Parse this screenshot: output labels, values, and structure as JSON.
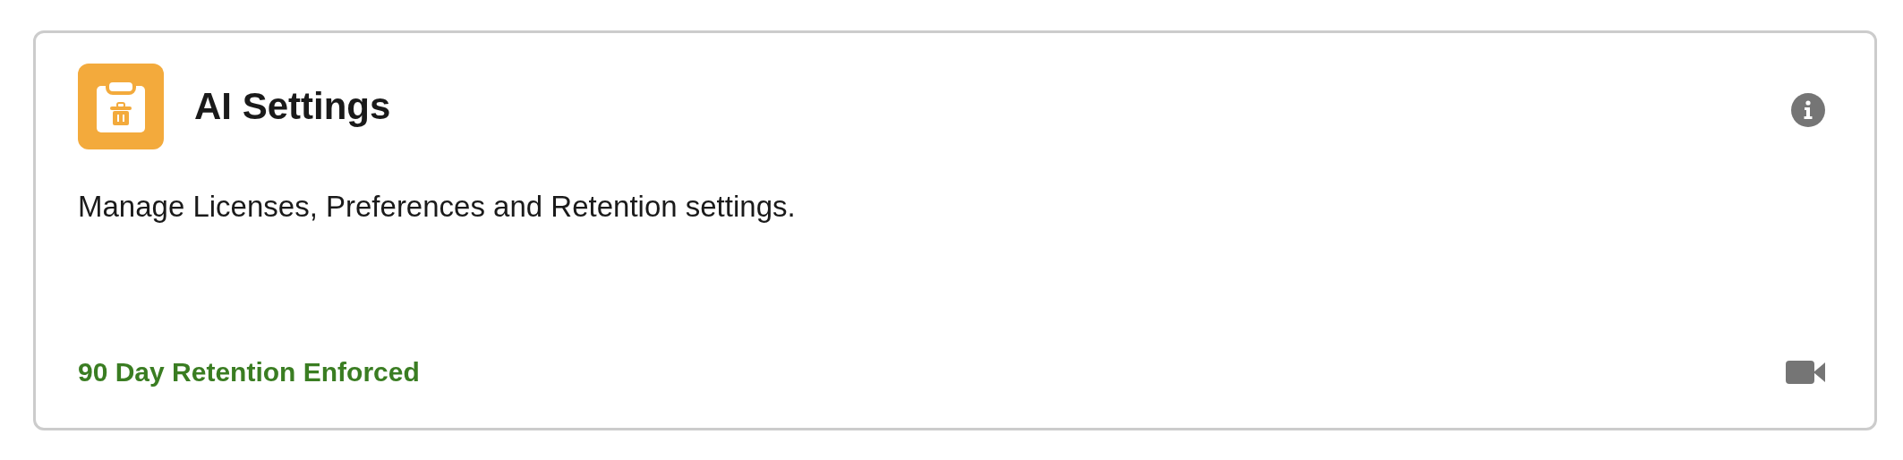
{
  "card": {
    "title": "AI Settings",
    "description": "Manage Licenses, Preferences and Retention settings.",
    "status": "90 Day Retention Enforced"
  }
}
